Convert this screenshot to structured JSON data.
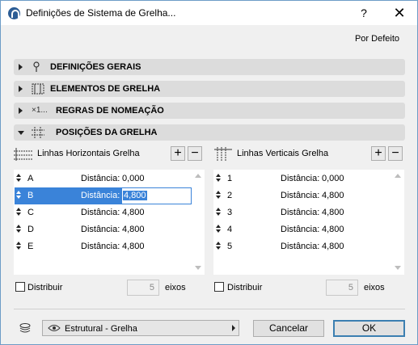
{
  "window": {
    "title": "Definições de Sistema de Grelha...",
    "help": "?",
    "close": "✕"
  },
  "defaults_label": "Por Defeito",
  "sections": [
    {
      "label": "DEFINIÇÕES GERAIS",
      "icon": "pin-icon",
      "state": "collapsed"
    },
    {
      "label": "ELEMENTOS DE GRELHA",
      "icon": "grid-element-icon",
      "state": "collapsed"
    },
    {
      "label": "REGRAS DE NOMEAÇÃO",
      "icon": "naming-icon",
      "icon_text": "×1...",
      "state": "collapsed"
    },
    {
      "label": "POSIÇÕES DA GRELHA",
      "icon": "grid-position-icon",
      "state": "expanded"
    }
  ],
  "horizontal": {
    "title": "Linhas Horizontais Grelha",
    "add": "+",
    "remove": "−",
    "rows": [
      {
        "name": "A",
        "label": "Distância:",
        "value": "0,000"
      },
      {
        "name": "B",
        "label": "Distância:",
        "value": "4,800",
        "selected": true
      },
      {
        "name": "C",
        "label": "Distância:",
        "value": "4,800"
      },
      {
        "name": "D",
        "label": "Distância:",
        "value": "4,800"
      },
      {
        "name": "E",
        "label": "Distância:",
        "value": "4,800"
      }
    ],
    "distribute_label": "Distribuir",
    "axes_count": "5",
    "axes_label": "eixos"
  },
  "vertical": {
    "title": "Linhas Verticais Grelha",
    "add": "+",
    "remove": "−",
    "rows": [
      {
        "name": "1",
        "label": "Distância:",
        "value": "0,000"
      },
      {
        "name": "2",
        "label": "Distância:",
        "value": "4,800"
      },
      {
        "name": "3",
        "label": "Distância:",
        "value": "4,800"
      },
      {
        "name": "4",
        "label": "Distância:",
        "value": "4,800"
      },
      {
        "name": "5",
        "label": "Distância:",
        "value": "4,800"
      }
    ],
    "distribute_label": "Distribuir",
    "axes_count": "5",
    "axes_label": "eixos"
  },
  "footer": {
    "layer": "Estrutural - Grelha",
    "cancel": "Cancelar",
    "ok": "OK"
  },
  "colors": {
    "selection": "#3a83d9",
    "section_bg": "#dcdcdc",
    "window_border": "#6d9cc7"
  }
}
